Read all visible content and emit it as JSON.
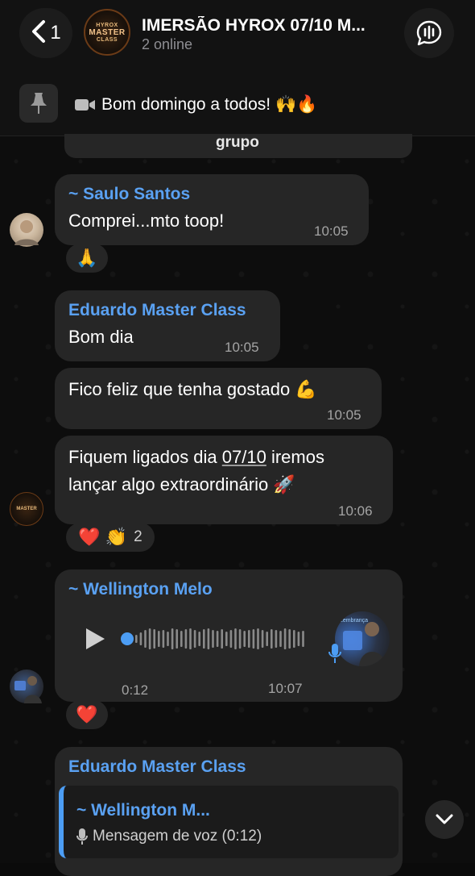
{
  "header": {
    "back_count": "1",
    "avatar_lines": [
      "HYROX",
      "MASTER",
      "CLASS"
    ],
    "title": "IMERSÃO HYROX 07/10 M...",
    "status": "2 online"
  },
  "pinned": {
    "text": "Bom domingo a todos! 🙌🔥"
  },
  "messages": {
    "partial": {
      "text": "grupo"
    },
    "saulo": {
      "sender": "~ Saulo Santos",
      "text": "Comprei...mto toop!",
      "time": "10:05",
      "reaction": "🙏"
    },
    "eduardo1": {
      "sender": "Eduardo Master Class",
      "text": "Bom dia",
      "time": "10:05"
    },
    "eduardo2": {
      "text": "Fico feliz que tenha gostado 💪",
      "time": "10:05"
    },
    "eduardo3": {
      "line1_before": "Fiquem ligados dia ",
      "line1_link": "07/10",
      "line1_after": " iremos",
      "line2": "lançar algo extraordinário 🚀",
      "time": "10:06",
      "reaction_emojis": "❤️ 👏",
      "reaction_count": "2"
    },
    "wellington": {
      "sender": "~ Wellington Melo",
      "duration": "0:12",
      "time": "10:07",
      "reaction": "❤️",
      "thumb_text": "Lembrança"
    },
    "eduardo4": {
      "sender": "Eduardo Master Class",
      "quote_sender": "~ Wellington M...",
      "quote_text": "Mensagem de voz (0:12)"
    }
  },
  "colors": {
    "accent": "#5aa1f2",
    "bubble": "#262626",
    "header": "#121212"
  }
}
